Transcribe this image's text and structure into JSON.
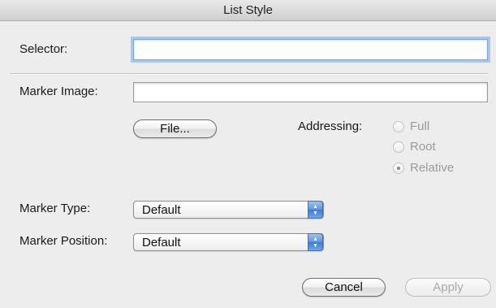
{
  "window": {
    "title": "List Style"
  },
  "selector": {
    "label": "Selector:",
    "value": ""
  },
  "marker_image": {
    "label": "Marker Image:",
    "value": ""
  },
  "file_button": {
    "label": "File..."
  },
  "addressing": {
    "label": "Addressing:",
    "options": [
      {
        "label": "Full",
        "selected": false
      },
      {
        "label": "Root",
        "selected": false
      },
      {
        "label": "Relative",
        "selected": true
      }
    ]
  },
  "marker_type": {
    "label": "Marker Type:",
    "value": "Default"
  },
  "marker_position": {
    "label": "Marker Position:",
    "value": "Default"
  },
  "buttons": {
    "cancel": "Cancel",
    "apply": "Apply"
  },
  "icons": {
    "stepper": "up-down-arrows-icon",
    "radio_selected": "radio-dot-icon"
  },
  "colors": {
    "focus_ring": "#a7c7ec",
    "popup_accent": "#3a7bd6",
    "disabled_text": "#9a9a9a"
  }
}
